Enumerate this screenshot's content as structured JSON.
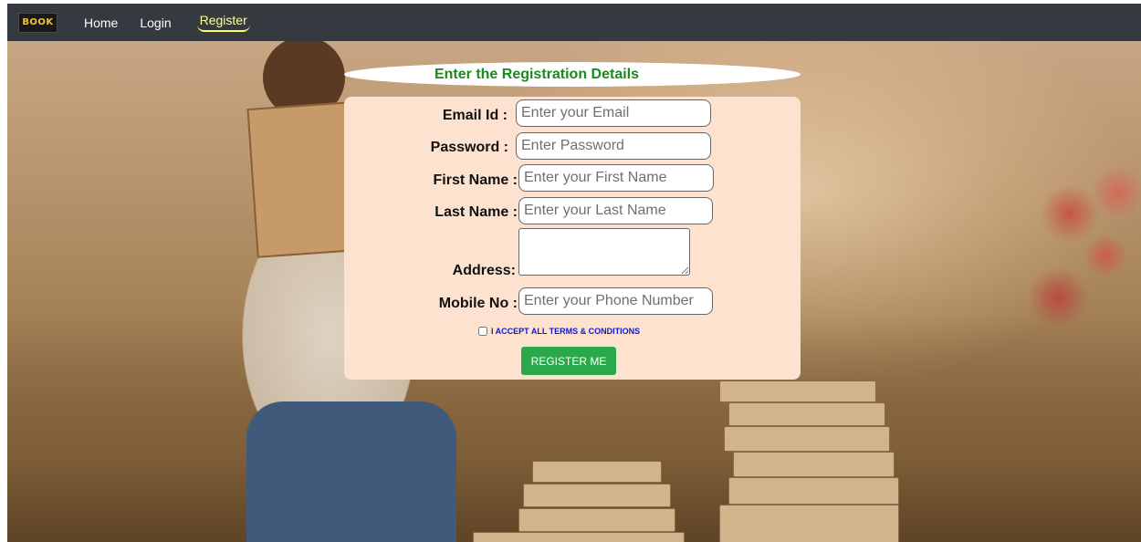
{
  "navbar": {
    "logo_text": "BOOK",
    "links": {
      "home": "Home",
      "login": "Login",
      "register": "Register"
    }
  },
  "form": {
    "heading": "Enter the Registration Details",
    "email": {
      "label": "Email Id :",
      "placeholder": "Enter your Email"
    },
    "password": {
      "label": "Password :",
      "placeholder": "Enter Password"
    },
    "first_name": {
      "label": "First Name :",
      "placeholder": "Enter your First Name"
    },
    "last_name": {
      "label": "Last Name :",
      "placeholder": "Enter your Last Name"
    },
    "address": {
      "label": "Address:"
    },
    "mobile": {
      "label": "Mobile No :",
      "placeholder": "Enter your Phone Number"
    },
    "terms_label": "I ACCEPT ALL TERMS & CONDITIONS",
    "submit_label": "REGISTER ME"
  },
  "colors": {
    "navbar_bg": "#343a40",
    "heading_green": "#198a1e",
    "form_bg": "#fde3cf",
    "button_green": "#2ba84a",
    "terms_blue": "#1414c8",
    "active_nav": "#ffff99"
  }
}
